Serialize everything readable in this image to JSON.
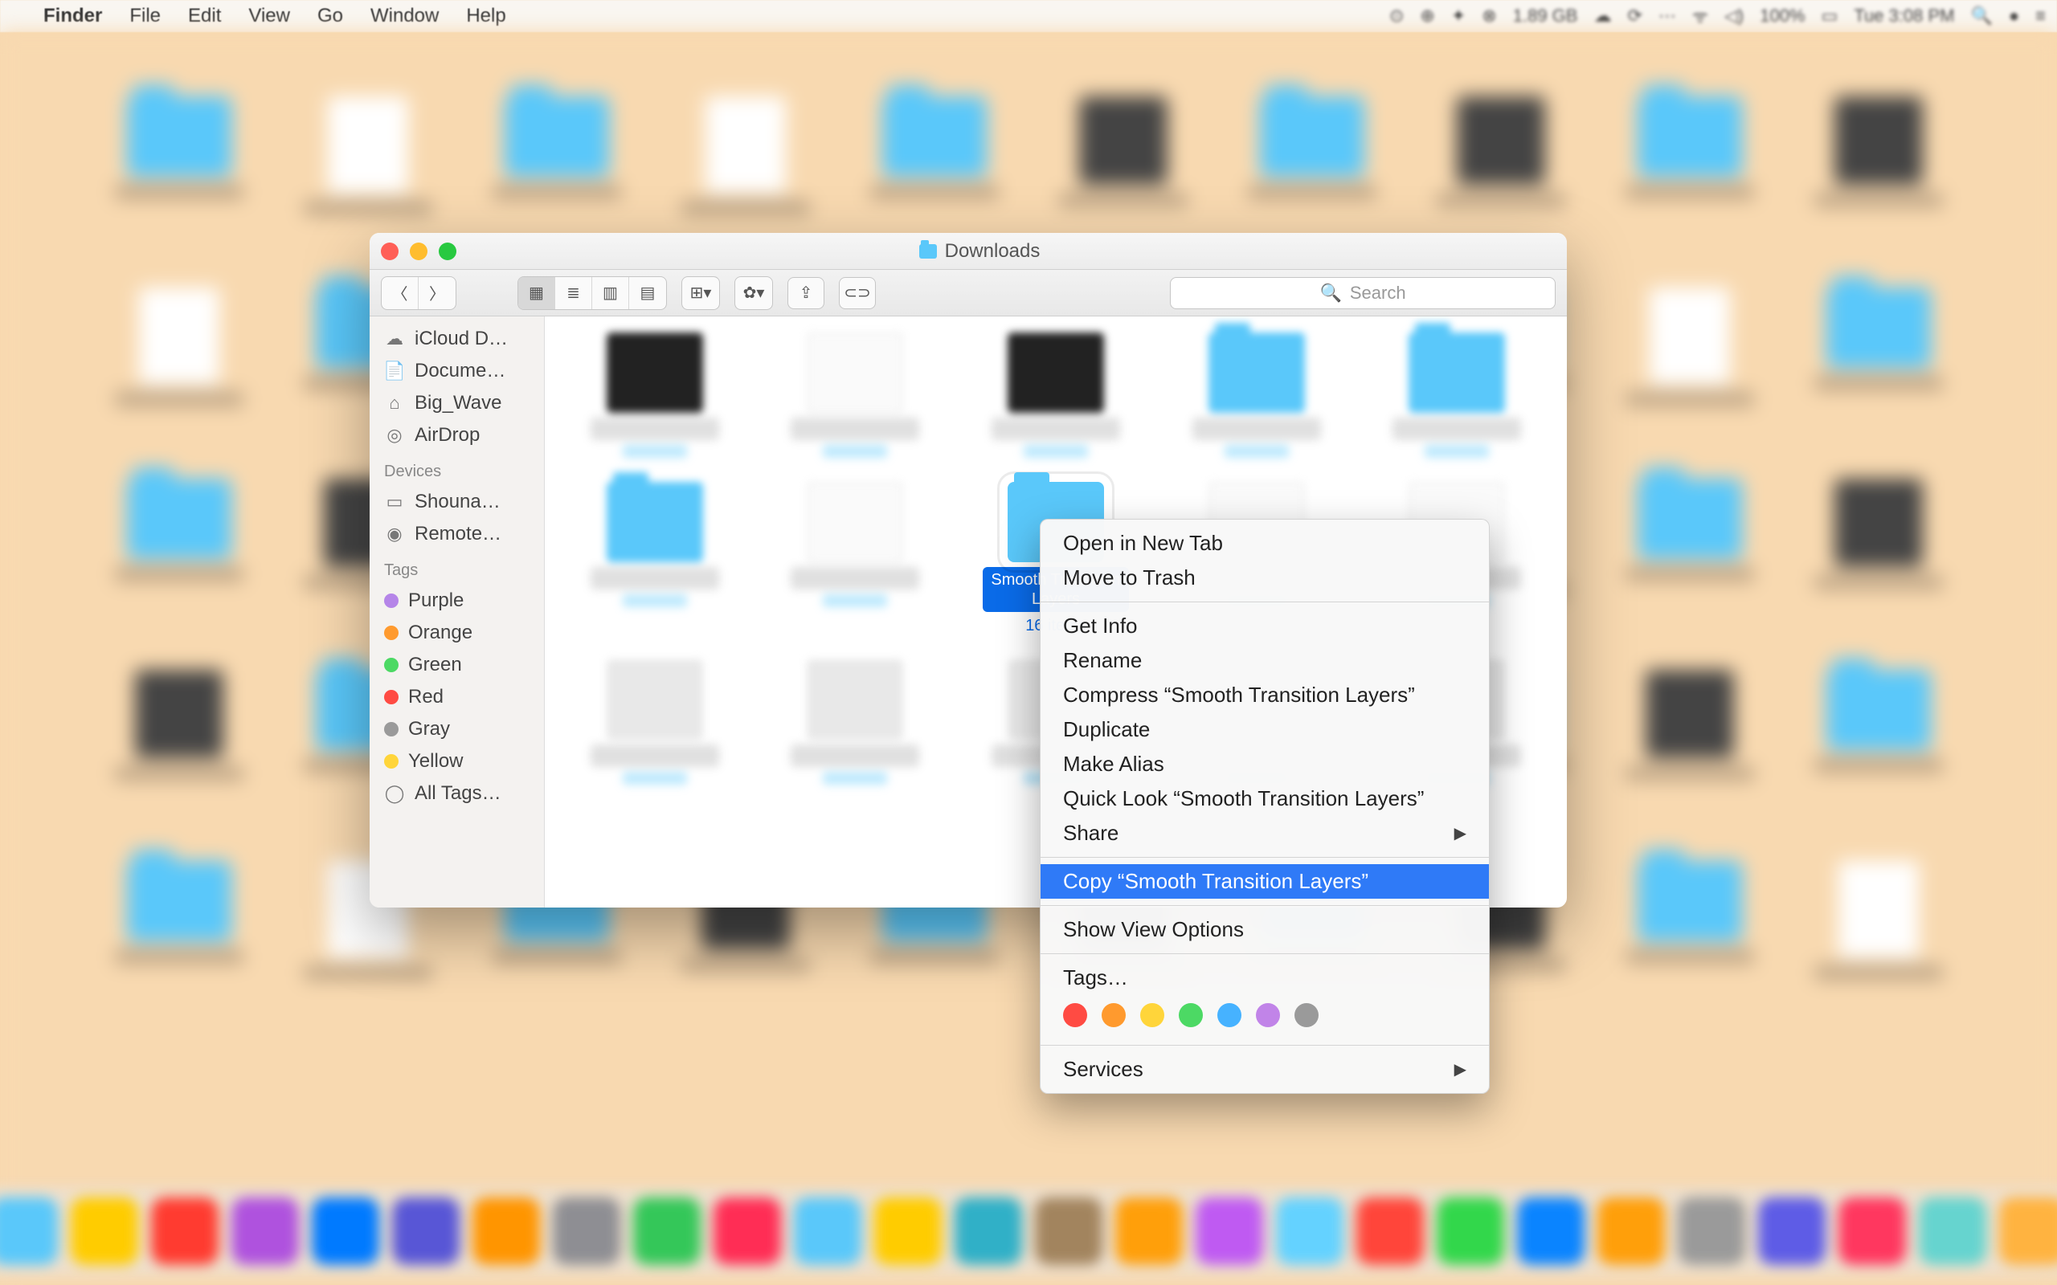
{
  "menubar": {
    "app": "Finder",
    "items": [
      "File",
      "Edit",
      "View",
      "Go",
      "Window",
      "Help"
    ],
    "status": {
      "mem": "1.89 GB",
      "battery": "100%",
      "clock": "Tue 3:08 PM"
    }
  },
  "finder": {
    "title": "Downloads",
    "search_placeholder": "Search",
    "sidebar": {
      "favorites": [
        {
          "label": "iCloud D…",
          "icon": "cloud"
        },
        {
          "label": "Docume…",
          "icon": "doc"
        },
        {
          "label": "Big_Wave",
          "icon": "home"
        },
        {
          "label": "AirDrop",
          "icon": "airdrop"
        }
      ],
      "devices_header": "Devices",
      "devices": [
        {
          "label": "Shouna…",
          "icon": "laptop"
        },
        {
          "label": "Remote…",
          "icon": "globe"
        }
      ],
      "tags_header": "Tags",
      "tags": [
        {
          "label": "Purple",
          "color": "#b585e8"
        },
        {
          "label": "Orange",
          "color": "#ff9a2e"
        },
        {
          "label": "Green",
          "color": "#4cd964"
        },
        {
          "label": "Red",
          "color": "#ff4b43"
        },
        {
          "label": "Gray",
          "color": "#9a9a9a"
        },
        {
          "label": "Yellow",
          "color": "#ffd53a"
        },
        {
          "label": "All Tags…",
          "color": null
        }
      ]
    },
    "selected_folder": {
      "name_line1": "Smooth Transition",
      "name_line2": "Layers",
      "meta": "16 items"
    }
  },
  "context_menu": {
    "items": [
      {
        "label": "Open in New Tab",
        "highlight": false
      },
      {
        "label": "Move to Trash",
        "highlight": false
      },
      {
        "sep": true
      },
      {
        "label": "Get Info",
        "highlight": false
      },
      {
        "label": "Rename",
        "highlight": false
      },
      {
        "label": "Compress “Smooth Transition Layers”",
        "highlight": false
      },
      {
        "label": "Duplicate",
        "highlight": false
      },
      {
        "label": "Make Alias",
        "highlight": false
      },
      {
        "label": "Quick Look “Smooth Transition Layers”",
        "highlight": false
      },
      {
        "label": "Share",
        "highlight": false,
        "submenu": true
      },
      {
        "sep": true
      },
      {
        "label": "Copy “Smooth Transition Layers”",
        "highlight": true
      },
      {
        "sep": true
      },
      {
        "label": "Show View Options",
        "highlight": false
      },
      {
        "sep": true
      },
      {
        "label": "Tags…",
        "highlight": false
      },
      {
        "tag_row": true,
        "colors": [
          "#ff4b43",
          "#ff9a2e",
          "#ffd53a",
          "#4cd964",
          "#46b2ff",
          "#c184e8",
          "#9a9a9a"
        ]
      },
      {
        "sep": true
      },
      {
        "label": "Services",
        "highlight": false,
        "submenu": true
      }
    ]
  },
  "dock_colors": [
    "#2a9df4",
    "#ff7a59",
    "#34c759",
    "#5ac8fa",
    "#ffcc00",
    "#ff3b30",
    "#af52de",
    "#007aff",
    "#5856d6",
    "#ff9500",
    "#8e8e93",
    "#34c759",
    "#ff2d55",
    "#5ac8fa",
    "#ffcc00",
    "#30b0c7",
    "#a2845e",
    "#ff9f0a",
    "#bf5af2",
    "#64d2ff",
    "#ff453a",
    "#32d74b",
    "#0a84ff",
    "#ff9f0a",
    "#9a9a9a",
    "#5e5ce6",
    "#ff375f",
    "#66d4cf",
    "#ffb340",
    "#8e8e93",
    "#5ac8fa",
    "#ff6961"
  ]
}
